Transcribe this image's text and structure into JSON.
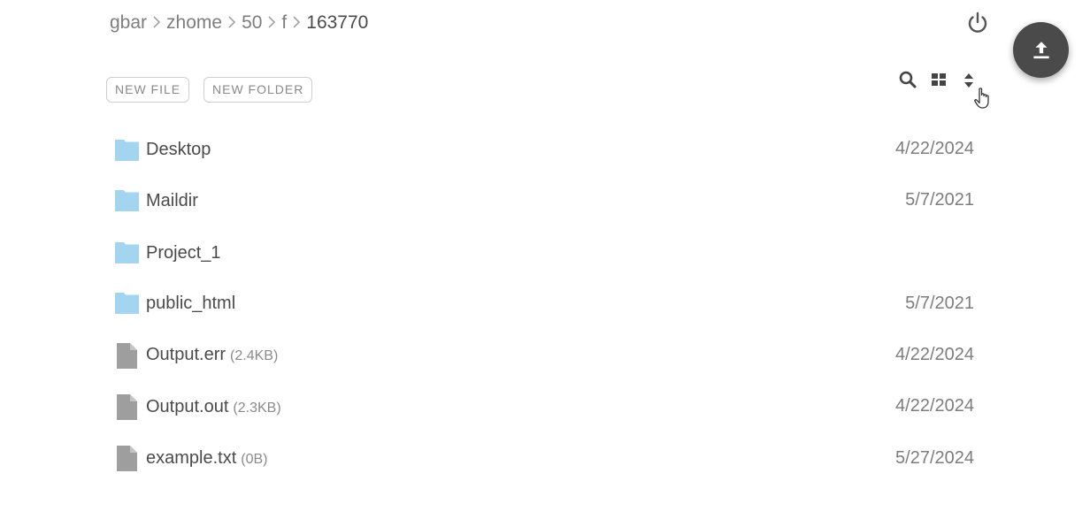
{
  "breadcrumb": [
    {
      "label": "gbar"
    },
    {
      "label": "zhome"
    },
    {
      "label": "50"
    },
    {
      "label": "f"
    },
    {
      "label": "163770"
    }
  ],
  "actions": {
    "new_file": "NEW FILE",
    "new_folder": "NEW FOLDER"
  },
  "icons": {
    "power": "power-icon",
    "upload": "upload-icon",
    "search": "search-icon",
    "grid": "grid-view-icon",
    "sort": "sort-icon",
    "folder": "folder-icon",
    "file": "file-icon"
  },
  "colors": {
    "folder": "#a3d5f0",
    "file": "#9e9e9e",
    "fab": "#4a4a4a",
    "text": "#4a4a4a",
    "muted": "#7d7d7d"
  },
  "files": [
    {
      "type": "folder",
      "name": "Desktop",
      "size": "",
      "date": "4/22/2024"
    },
    {
      "type": "folder",
      "name": "Maildir",
      "size": "",
      "date": "5/7/2021"
    },
    {
      "type": "folder",
      "name": "Project_1",
      "size": "",
      "date": ""
    },
    {
      "type": "folder",
      "name": "public_html",
      "size": "",
      "date": "5/7/2021"
    },
    {
      "type": "file",
      "name": "Output.err",
      "size": "(2.4KB)",
      "date": "4/22/2024"
    },
    {
      "type": "file",
      "name": "Output.out",
      "size": "(2.3KB)",
      "date": "4/22/2024"
    },
    {
      "type": "file",
      "name": "example.txt",
      "size": "(0B)",
      "date": "5/27/2024"
    }
  ]
}
